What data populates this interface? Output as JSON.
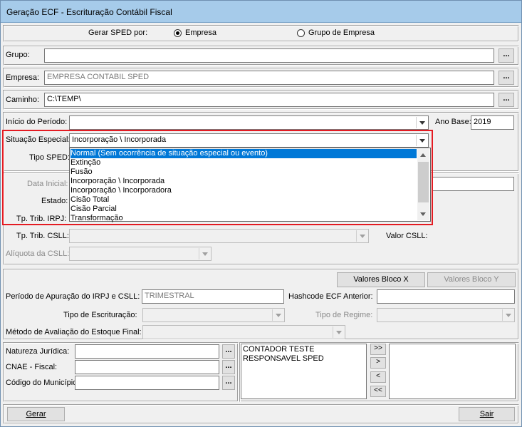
{
  "window": {
    "title": "Geração ECF - Escrituração Contábil Fiscal"
  },
  "gerar_por": {
    "label": "Gerar SPED por:",
    "options": [
      {
        "label": "Empresa",
        "checked": true
      },
      {
        "label": "Grupo de Empresa",
        "checked": false
      }
    ]
  },
  "grupo": {
    "label": "Grupo:",
    "value": "",
    "browse": "..."
  },
  "empresa": {
    "label": "Empresa:",
    "value": "EMPRESA CONTABIL SPED",
    "browse": "..."
  },
  "caminho": {
    "label": "Caminho:",
    "value": "C:\\TEMP\\",
    "browse": "..."
  },
  "periodo": {
    "label": "Início do Período:",
    "value": ""
  },
  "ano_base": {
    "label": "Ano Base:",
    "value": "2019"
  },
  "situacao": {
    "label": "Situação Especial:",
    "value": "Incorporação \\ Incorporada",
    "options": [
      "Normal (Sem ocorrência de situação especial ou evento)",
      "Extinção",
      "Fusão",
      "Incorporação \\ Incorporada",
      "Incorporação \\ Incorporadora",
      "Cisão Total",
      "Cisão Parcial",
      "Transformação"
    ],
    "selected_index": 0
  },
  "tipo_sped": {
    "label": "Tipo SPED:"
  },
  "data_inicial": {
    "label": "Data Inicial:"
  },
  "estado": {
    "label": "Estado:"
  },
  "tp_trib_irpj": {
    "label": "Tp. Trib. IRPJ:"
  },
  "tp_trib_csll": {
    "label": "Tp. Trib. CSLL:",
    "value": ""
  },
  "valor_csll": {
    "label": "Valor CSLL:"
  },
  "aliquota_csll": {
    "label": "Alíquota da CSLL:",
    "value": ""
  },
  "valores_bloco_x": "Valores Bloco X",
  "valores_bloco_y": "Valores Bloco Y",
  "periodo_apuracao": {
    "label": "Período de Apuração do IRPJ e CSLL:",
    "value": "TRIMESTRAL"
  },
  "hashcode": {
    "label": "Hashcode ECF Anterior:",
    "value": ""
  },
  "tipo_escrituracao": {
    "label": "Tipo de Escrituração:",
    "value": ""
  },
  "tipo_regime": {
    "label": "Tipo de Regime:",
    "value": ""
  },
  "metodo_estoque": {
    "label": "Método de Avaliação do Estoque Final:",
    "value": ""
  },
  "natureza": {
    "label": "Natureza Jurídica:",
    "value": "",
    "browse": "..."
  },
  "cnae": {
    "label": "CNAE - Fiscal:",
    "value": "",
    "browse": "..."
  },
  "municipio": {
    "label": "Código do Município:",
    "value": "",
    "browse": "..."
  },
  "signatarios": {
    "available": [
      "CONTADOR TESTE",
      "RESPONSAVEL SPED"
    ],
    "selected": []
  },
  "transfer": {
    "all_right": ">>",
    "right": ">",
    "left": "<",
    "all_left": "<<"
  },
  "footer": {
    "gerar": "Gerar",
    "sair": "Sair"
  }
}
